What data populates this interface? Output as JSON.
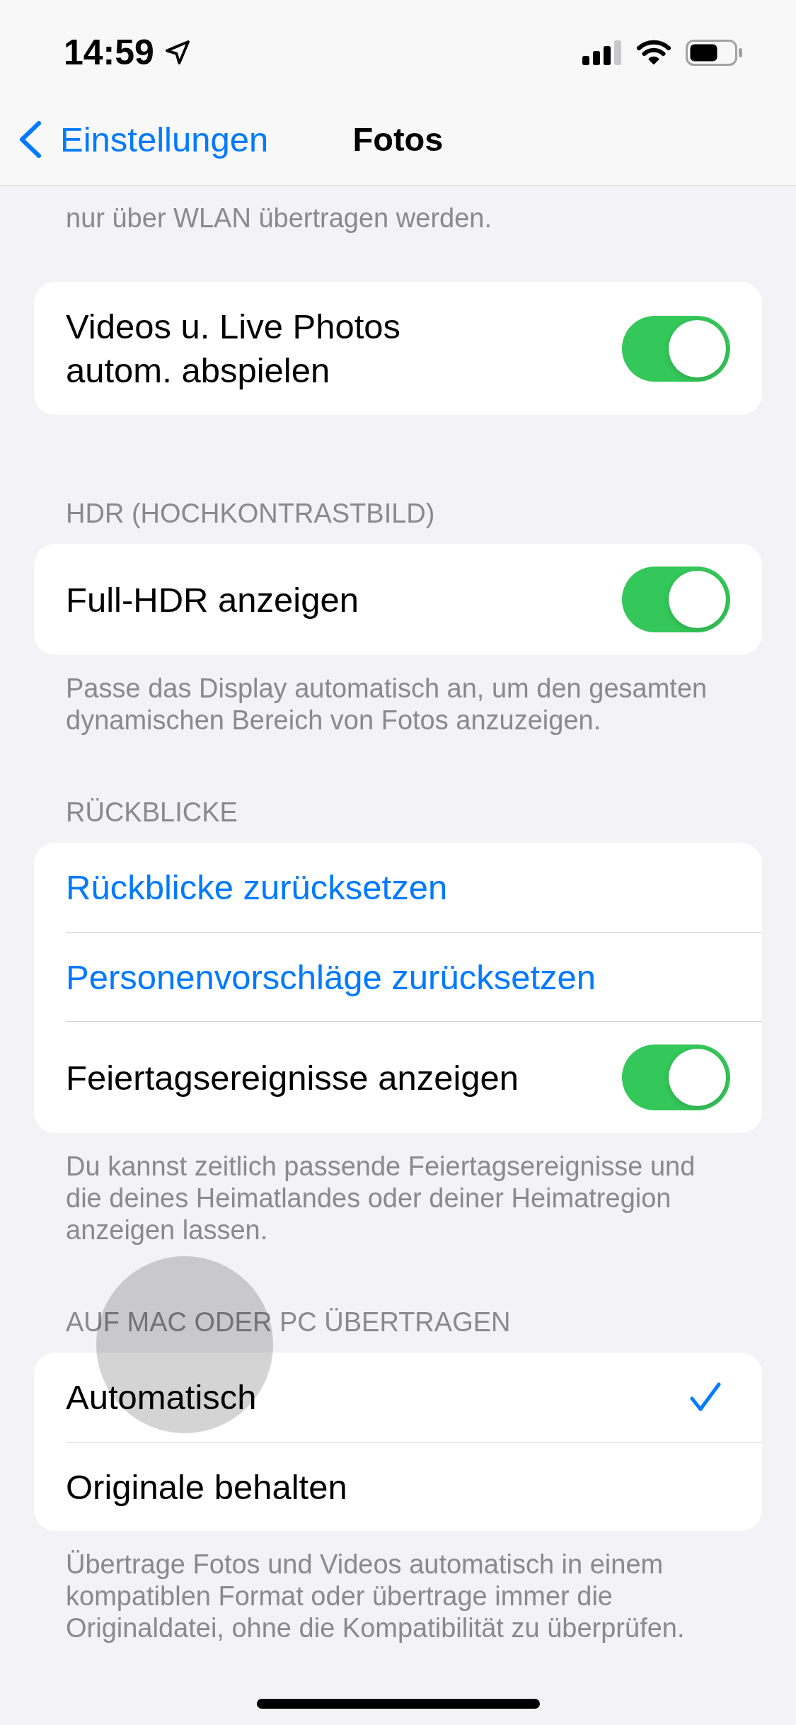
{
  "status_bar": {
    "time": "14:59"
  },
  "nav_bar": {
    "back_label": "Einstellungen",
    "title": "Fotos"
  },
  "top_footer": "nur über WLAN übertragen werden.",
  "sections": [
    {
      "rows": [
        {
          "kind": "toggle",
          "label": "Videos u. Live Photos\nautom. abspielen",
          "on": true
        }
      ]
    },
    {
      "header": "HDR (HOCHKONTRASTBILD)",
      "rows": [
        {
          "kind": "toggle",
          "label": "Full-HDR anzeigen",
          "on": true
        }
      ],
      "footer": "Passe das Display automatisch an, um den gesamten dynamischen Bereich von Fotos anzuzeigen."
    },
    {
      "header": "RÜCKBLICKE",
      "rows": [
        {
          "kind": "action",
          "label": "Rückblicke zurücksetzen"
        },
        {
          "kind": "action",
          "label": "Personenvorschläge zurücksetzen"
        },
        {
          "kind": "toggle",
          "label": "Feiertagsereignisse anzeigen",
          "on": true
        }
      ],
      "footer": "Du kannst zeitlich passende Feiertagsereignisse und die deines Heimatlandes oder deiner Heimatregion anzeigen lassen."
    },
    {
      "header": "AUF MAC ODER PC ÜBERTRAGEN",
      "rows": [
        {
          "kind": "option",
          "label": "Automatisch",
          "selected": true
        },
        {
          "kind": "option",
          "label": "Originale behalten",
          "selected": false
        }
      ],
      "footer": "Übertrage Fotos und Videos automatisch in einem kompatiblen Format oder übertrage immer die Originaldatei, ohne die Kompatibilität zu überprüfen."
    }
  ]
}
